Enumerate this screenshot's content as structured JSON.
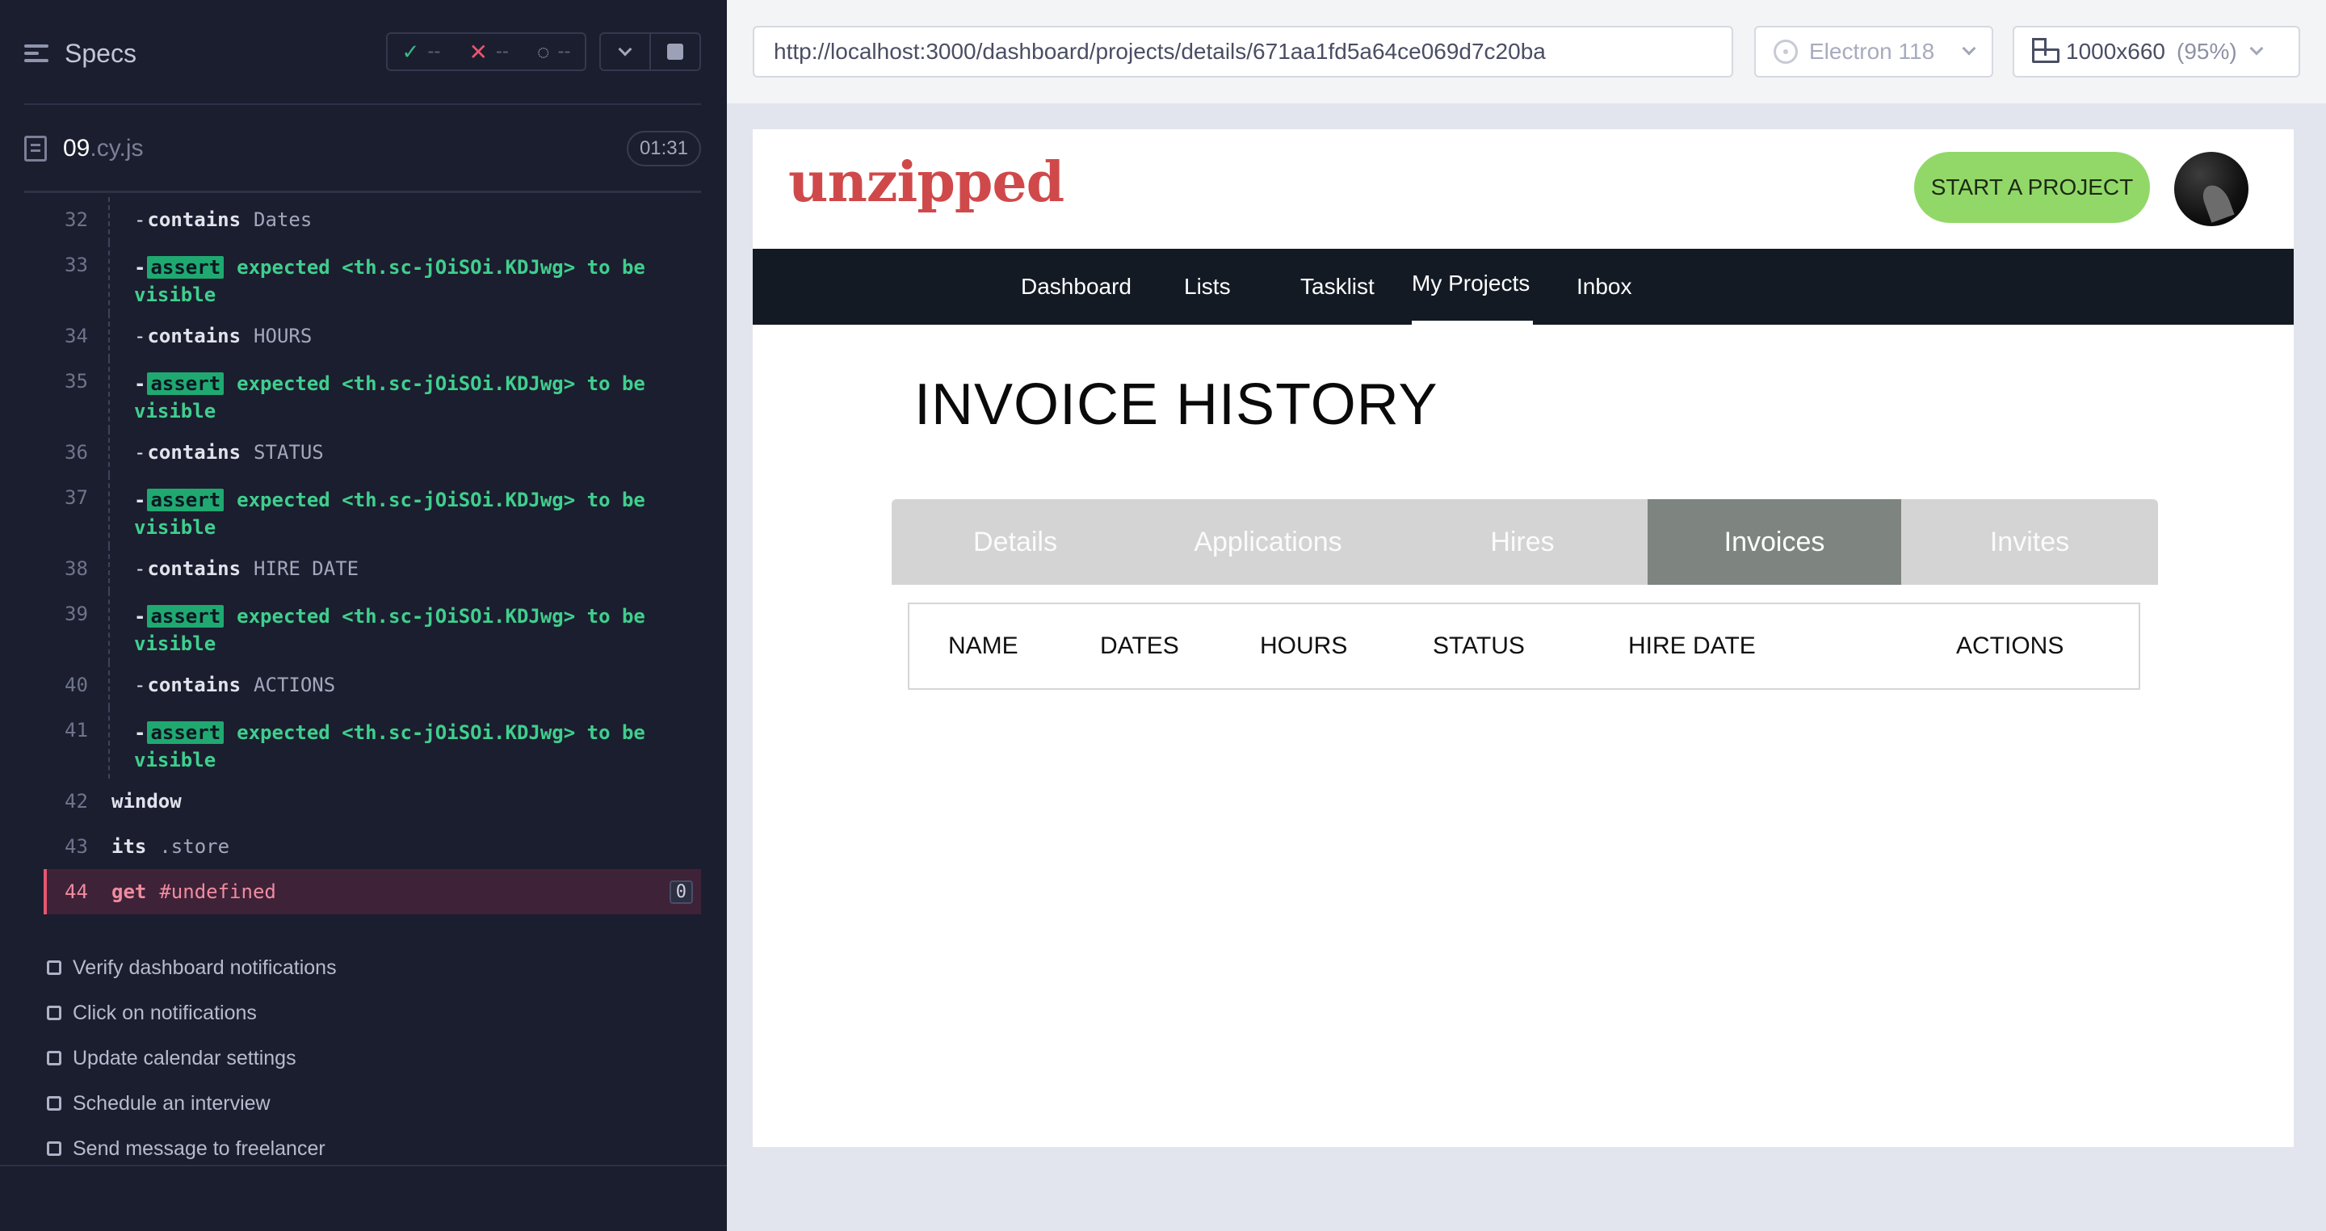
{
  "reporter": {
    "specs_label": "Specs",
    "stats": {
      "passed": "--",
      "failed": "--",
      "pending": "--"
    },
    "file": {
      "name": "09",
      "ext": ".cy.js",
      "time": "01:31"
    },
    "commands": [
      {
        "num": "32",
        "nested": true,
        "type": "contains",
        "name": "contains",
        "msg": "Dates"
      },
      {
        "num": "33",
        "nested": true,
        "type": "assert",
        "name": "assert",
        "line1": "expected <th.sc-jOiSOi.KDJwg> to be",
        "line2": "visible"
      },
      {
        "num": "34",
        "nested": true,
        "type": "contains",
        "name": "contains",
        "msg": "HOURS"
      },
      {
        "num": "35",
        "nested": true,
        "type": "assert",
        "name": "assert",
        "line1": "expected <th.sc-jOiSOi.KDJwg> to be",
        "line2": "visible"
      },
      {
        "num": "36",
        "nested": true,
        "type": "contains",
        "name": "contains",
        "msg": "STATUS"
      },
      {
        "num": "37",
        "nested": true,
        "type": "assert",
        "name": "assert",
        "line1": "expected <th.sc-jOiSOi.KDJwg> to be",
        "line2": "visible"
      },
      {
        "num": "38",
        "nested": true,
        "type": "contains",
        "name": "contains",
        "msg": "HIRE DATE"
      },
      {
        "num": "39",
        "nested": true,
        "type": "assert",
        "name": "assert",
        "line1": "expected <th.sc-jOiSOi.KDJwg> to be",
        "line2": "visible"
      },
      {
        "num": "40",
        "nested": true,
        "type": "contains",
        "name": "contains",
        "msg": "ACTIONS"
      },
      {
        "num": "41",
        "nested": true,
        "type": "assert",
        "name": "assert",
        "line1": "expected <th.sc-jOiSOi.KDJwg> to be",
        "line2": "visible"
      },
      {
        "num": "42",
        "nested": false,
        "type": "plain",
        "name": "window",
        "msg": ""
      },
      {
        "num": "43",
        "nested": false,
        "type": "plain",
        "name": "its",
        "msg": ".store"
      },
      {
        "num": "44",
        "nested": false,
        "type": "failed",
        "name": "get",
        "msg": "#undefined",
        "badge": "0"
      }
    ],
    "tests": [
      "Verify dashboard notifications",
      "Click on notifications",
      "Update calendar settings",
      "Schedule an interview",
      "Send message to freelancer"
    ]
  },
  "aut_header": {
    "url": "http://localhost:3000/dashboard/projects/details/671aa1fd5a64ce069d7c20ba",
    "browser": "Electron 118",
    "viewport": "1000x660",
    "viewport_pct": "(95%)"
  },
  "app": {
    "logo": "unzipped",
    "start_button": "START A PROJECT",
    "nav": [
      "Dashboard",
      "Lists",
      "Tasklist",
      "My Projects",
      "Inbox"
    ],
    "nav_active": "My Projects",
    "page_title": "INVOICE HISTORY",
    "tabs": [
      "Details",
      "Applications",
      "Hires",
      "Invoices",
      "Invites"
    ],
    "tab_active": "Invoices",
    "table_headers": [
      "NAME",
      "DATES",
      "HOURS",
      "STATUS",
      "HIRE DATE",
      "ACTIONS"
    ],
    "colors": {
      "brand": "#d0494a",
      "cta": "#92d868",
      "nav_bg": "#131a24",
      "active_tab": "#7e8580"
    }
  }
}
